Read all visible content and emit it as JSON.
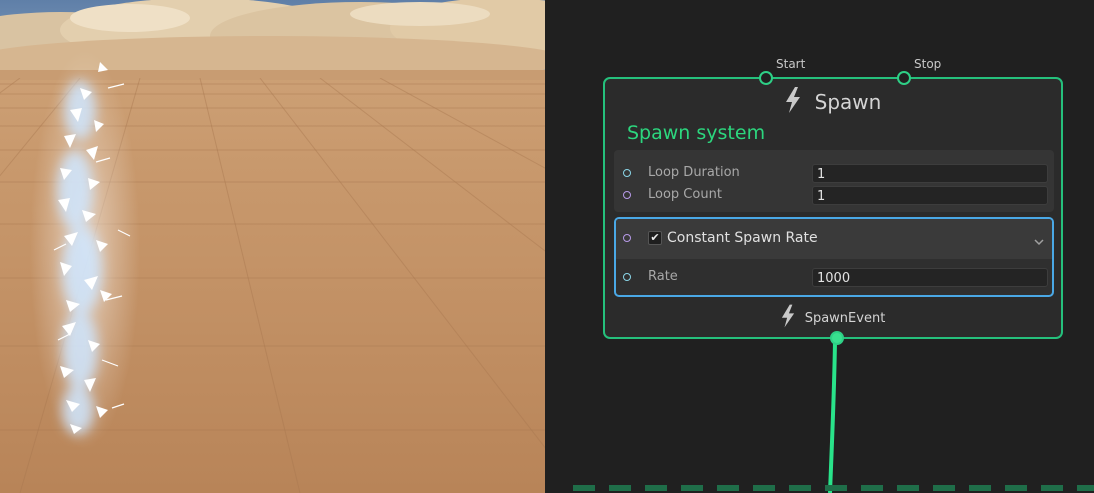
{
  "node": {
    "title": "Spawn",
    "subtitle": "Spawn system",
    "inputs": {
      "start": "Start",
      "stop": "Stop"
    },
    "settings": [
      {
        "label": "Loop Duration",
        "value": "1"
      },
      {
        "label": "Loop Count",
        "value": "1"
      }
    ],
    "block": {
      "title": "Constant Spawn Rate",
      "enabled": "✔",
      "rate_label": "Rate",
      "rate_value": "1000"
    },
    "output_label": "SpawnEvent"
  },
  "colors": {
    "node_border": "#25c07c",
    "subtitle": "#2cd67e",
    "block_selected": "#4aa8e6",
    "wire": "#29e38a"
  },
  "icons": {
    "header": "lightning-bolt-icon",
    "footer": "lightning-bolt-icon",
    "collapse": "chevron-down-icon"
  }
}
